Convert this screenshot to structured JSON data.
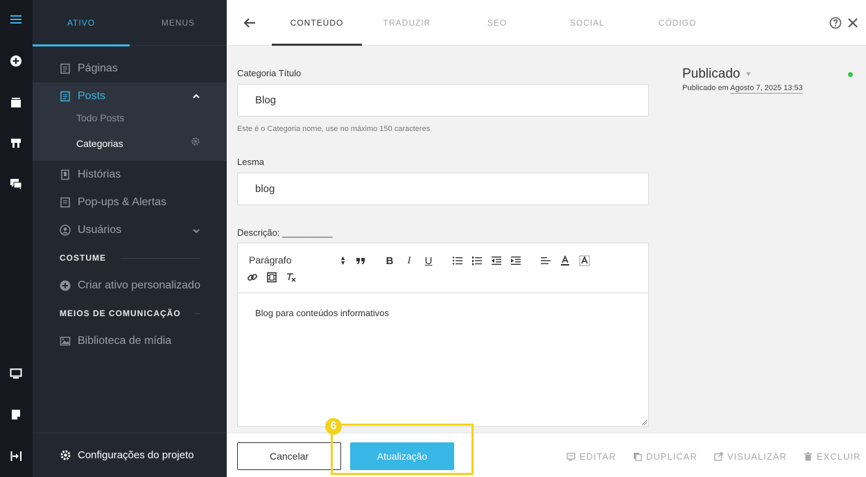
{
  "rail": {
    "icons": [
      "menu-icon",
      "add-circle-icon",
      "folder-icon",
      "sign-icon",
      "chat-icon",
      "monitor-icon",
      "note-icon",
      "exit-icon"
    ],
    "accent": "#38b6e6"
  },
  "sidebar": {
    "tabs": [
      {
        "label": "ATIVO"
      },
      {
        "label": "MENUS"
      }
    ],
    "items": {
      "paginas": "Páginas",
      "posts": "Posts",
      "todo_posts": "Todo Posts",
      "categorias": "Categorias",
      "historias": "Histórias",
      "popups": "Pop-ups & Alertas",
      "usuarios": "Usuários"
    },
    "section_costume": "COSTUME",
    "custom_asset": "Criar ativo personalizado",
    "section_media": "MEIOS DE COMUNICAÇÃO",
    "media_library": "Biblioteca de mídia",
    "footer": "Configurações do projeto"
  },
  "header": {
    "tabs": [
      {
        "label": "CONTEÚDO"
      },
      {
        "label": "TRADUZIR"
      },
      {
        "label": "SEO"
      },
      {
        "label": "SOCIAL"
      },
      {
        "label": "CÓDIGO"
      }
    ]
  },
  "form": {
    "title_label": "Categoria Título",
    "title_value": "Blog",
    "title_hint": "Este é o Categoria nome, use no máximo 150 caracteres",
    "slug_label": "Lesma",
    "slug_value": "blog",
    "desc_label": "Descrição: __________",
    "paragraph_select": "Parágrafo",
    "desc_content": "Blog para conteúdos informativos"
  },
  "status": {
    "state": "Publicado",
    "published_prefix": "Publicado em",
    "published_date": "Agosto 7, 2025 13:53",
    "dot_color": "#2ecc40"
  },
  "footer": {
    "cancel": "Cancelar",
    "update": "Atualização",
    "actions": {
      "edit": "EDITAR",
      "duplicate": "DUPLICAR",
      "preview": "VISUALIZAR",
      "delete": "EXCLUIR"
    }
  },
  "annotation": {
    "badge": "6",
    "color": "#f3d21b"
  }
}
